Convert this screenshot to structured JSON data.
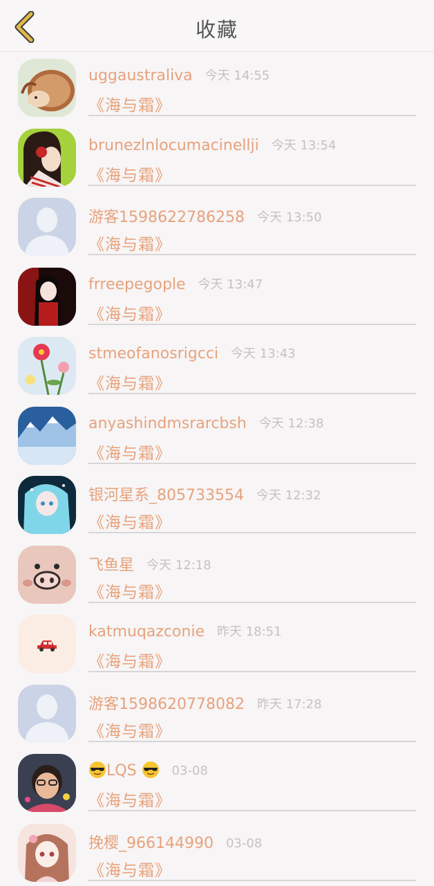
{
  "header": {
    "title": "收藏",
    "back_icon": "chevron-left-icon",
    "accent": "#e0b94a"
  },
  "colors": {
    "accent": "#e7a27c",
    "meta": "#c4c1c2",
    "background": "#f7f5f6"
  },
  "items": [
    {
      "name": "uggaustraliva",
      "time": "今天 14:55",
      "title": "《海与霜》",
      "avatar": "hedgehog-avatar"
    },
    {
      "name": "brunezlnlocumacinellji",
      "time": "今天 13:54",
      "title": "《海与霜》",
      "avatar": "girl-headphones-avatar"
    },
    {
      "name": "游客1598622786258",
      "time": "今天 13:50",
      "title": "《海与霜》",
      "avatar": "default-user-avatar"
    },
    {
      "name": "frreepegople",
      "time": "今天 13:47",
      "title": "《海与霜》",
      "avatar": "anime-girl-red-avatar"
    },
    {
      "name": "stmeofanosrigcci",
      "time": "今天 13:43",
      "title": "《海与霜》",
      "avatar": "flowers-avatar"
    },
    {
      "name": "anyashindmsrarcbsh",
      "time": "今天 12:38",
      "title": "《海与霜》",
      "avatar": "snowy-landscape-avatar"
    },
    {
      "name": "银河星系_805733554",
      "time": "今天 12:32",
      "title": "《海与霜》",
      "avatar": "anime-girl-blue-avatar"
    },
    {
      "name": "飞鱼星",
      "time": "今天 12:18",
      "title": "《海与霜》",
      "avatar": "pig-avatar"
    },
    {
      "name": "katmuqazconie",
      "time": "昨天 18:51",
      "title": "《海与霜》",
      "avatar": "car-avatar"
    },
    {
      "name": "游客1598620778082",
      "time": "昨天 17:28",
      "title": "《海与霜》",
      "avatar": "default-user-avatar"
    },
    {
      "name": "LQS",
      "time": "03-08",
      "title": "《海与霜》",
      "avatar": "child-photo-avatar",
      "emoji": "sunglasses-emoji"
    },
    {
      "name": "挽樱_966144990",
      "time": "03-08",
      "title": "《海与霜》",
      "avatar": "anime-girl-pink-avatar"
    }
  ]
}
